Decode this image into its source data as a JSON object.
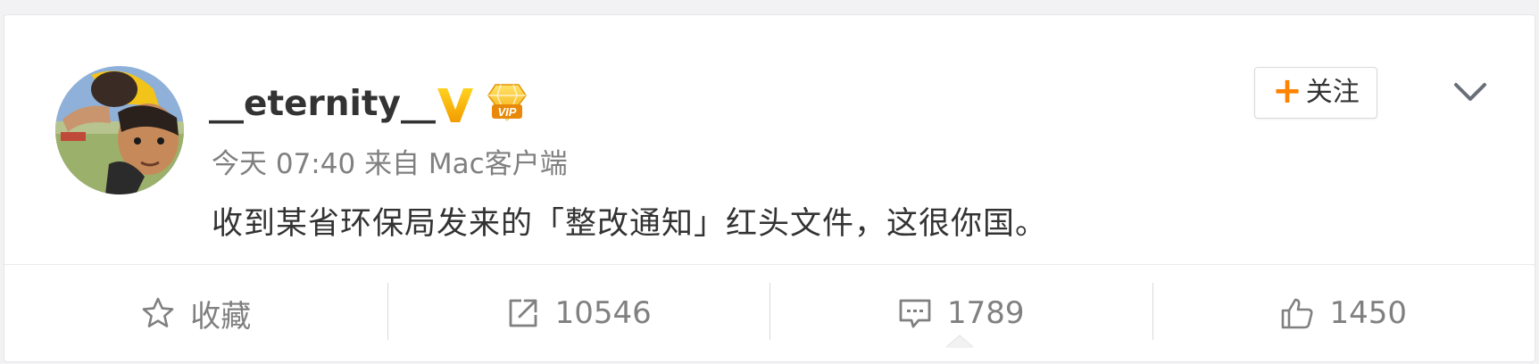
{
  "post": {
    "username": "__eternity__",
    "time": "今天 07:40",
    "source_prefix": "来自",
    "source": "Mac客户端",
    "content": "收到某省环保局发来的「整改通知」红头文件，这很你国。"
  },
  "badges": {
    "verified_icon": "verified-v-icon",
    "vip_icon": "vip-diamond-icon",
    "verified_color": "#f5b400",
    "vip_color": "#f7b500"
  },
  "follow": {
    "plus": "+",
    "label": "关注",
    "plus_color": "#ff8200"
  },
  "more": {
    "icon": "chevron-down-icon"
  },
  "actions": {
    "favorite": {
      "label": "收藏",
      "icon": "star-outline-icon"
    },
    "repost": {
      "count": "10546",
      "icon": "share-arrow-icon"
    },
    "comment": {
      "count": "1789",
      "icon": "comment-bubble-icon"
    },
    "like": {
      "count": "1450",
      "icon": "thumbs-up-icon"
    }
  }
}
